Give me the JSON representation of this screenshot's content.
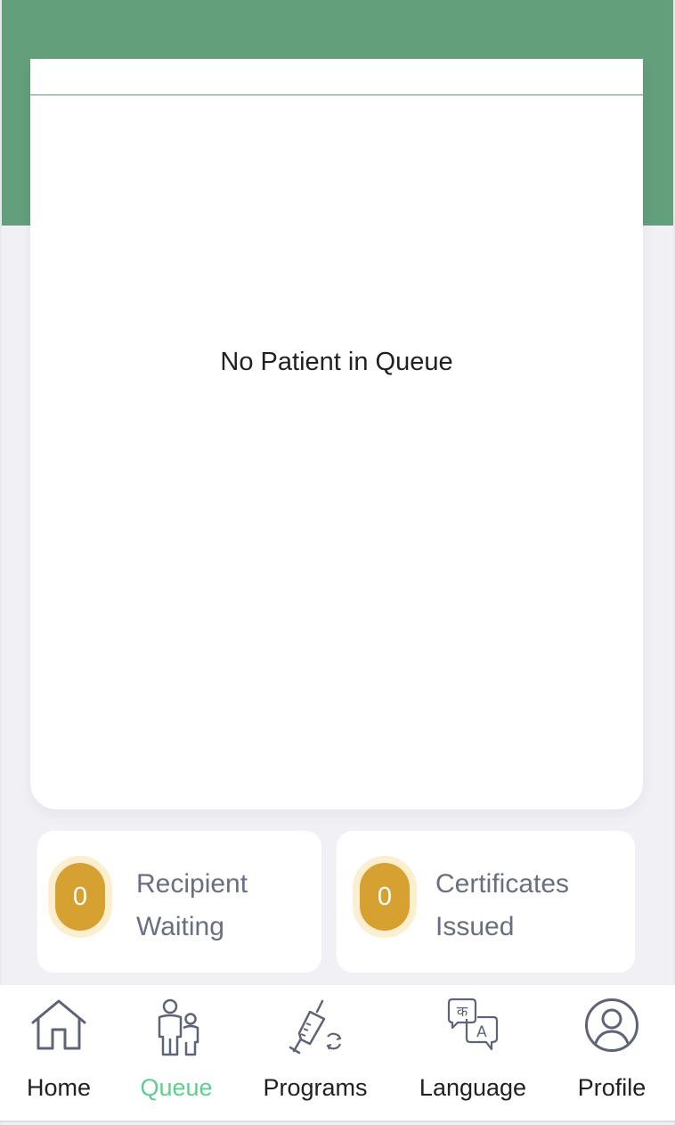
{
  "queue": {
    "empty_message": "No Patient in Queue"
  },
  "stats": [
    {
      "count": "0",
      "label_line1": "Recipient",
      "label_line2": "Waiting"
    },
    {
      "count": "0",
      "label_line1": "Certificates",
      "label_line2": "Issued"
    }
  ],
  "tabs": [
    {
      "label": "Home",
      "icon": "home-icon",
      "active": false
    },
    {
      "label": "Queue",
      "icon": "queue-people-icon",
      "active": true
    },
    {
      "label": "Programs",
      "icon": "vaccine-syringe-icon",
      "active": false
    },
    {
      "label": "Language",
      "icon": "language-translate-icon",
      "active": false
    },
    {
      "label": "Profile",
      "icon": "profile-user-icon",
      "active": false
    }
  ],
  "colors": {
    "header_green": "#639f7b",
    "badge_gold": "#d7a132",
    "badge_halo": "#fbefcf",
    "active_tab": "#5ccf8e",
    "page_bg": "#f0f0f5"
  }
}
